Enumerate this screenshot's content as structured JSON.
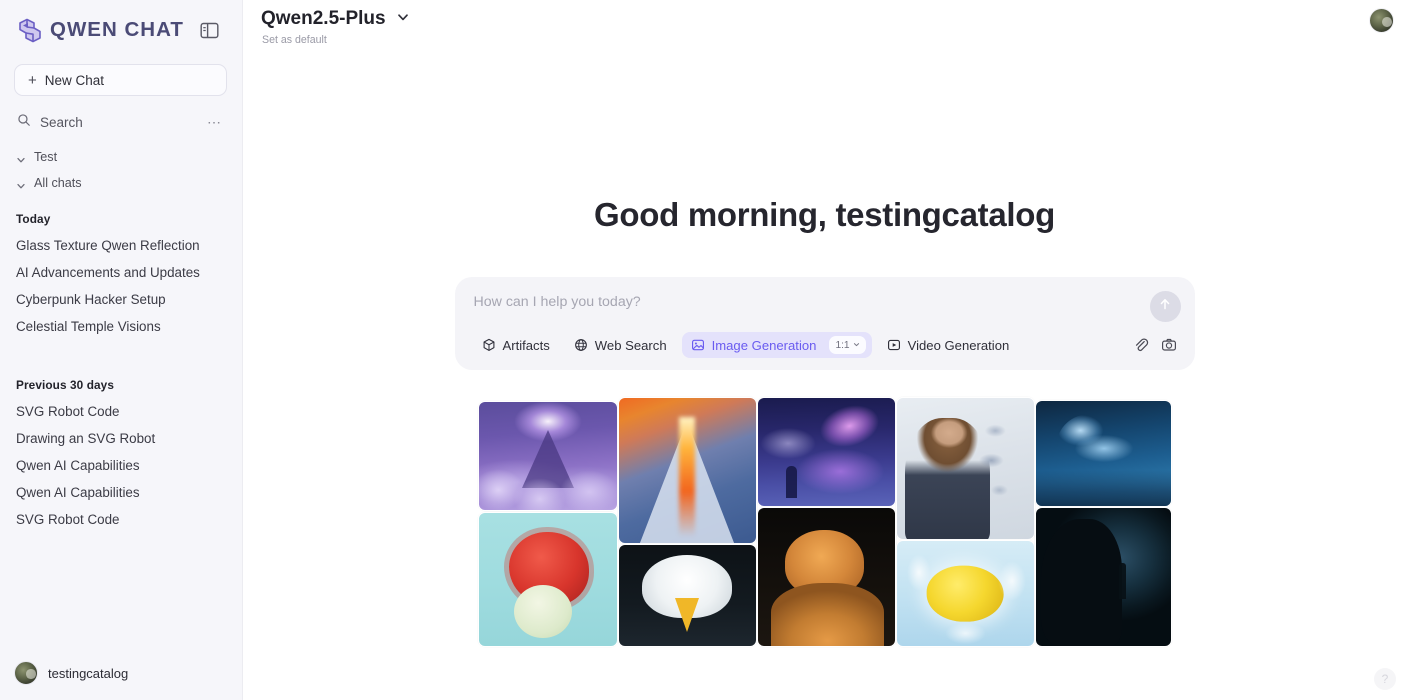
{
  "brand": {
    "name": "QWEN CHAT",
    "logo_icon": "qwen-logo-icon",
    "panel_toggle_icon": "panel-toggle-icon",
    "accent": "#6a5cf0",
    "brand_color": "#4b4b76"
  },
  "sidebar": {
    "new_chat_label": "New Chat",
    "new_chat_icon": "plus-icon",
    "search_label": "Search",
    "search_icon": "search-icon",
    "more_icon": "ellipsis-icon",
    "groups": [
      {
        "label": "Test",
        "icon": "chevron-down-icon"
      },
      {
        "label": "All chats",
        "icon": "chevron-down-icon"
      }
    ],
    "sections": [
      {
        "label": "Today",
        "items": [
          "Glass Texture Qwen Reflection",
          "AI Advancements and Updates",
          "Cyberpunk Hacker Setup",
          "Celestial Temple Visions"
        ]
      },
      {
        "label": "Previous 30 days",
        "items": [
          "SVG Robot Code",
          "Drawing an SVG Robot",
          "Qwen AI Capabilities",
          "Qwen AI Capabilities",
          "SVG Robot Code"
        ]
      }
    ],
    "footer": {
      "username": "testingcatalog",
      "avatar_icon": "user-avatar"
    }
  },
  "topbar": {
    "model_name": "Qwen2.5-Plus",
    "model_chevron_icon": "chevron-down-icon",
    "set_default_label": "Set as default",
    "avatar_icon": "user-avatar"
  },
  "main": {
    "greeting": "Good morning, testingcatalog",
    "composer": {
      "placeholder": "How can I help you today?",
      "send_icon": "arrow-up-icon",
      "tools": [
        {
          "label": "Artifacts",
          "icon": "cube-icon",
          "active": false
        },
        {
          "label": "Web Search",
          "icon": "globe-icon",
          "active": false
        },
        {
          "label": "Image Generation",
          "icon": "image-icon",
          "active": true,
          "ratio": "1:1",
          "ratio_icon": "chevron-down-icon"
        },
        {
          "label": "Video Generation",
          "icon": "video-icon",
          "active": false
        }
      ],
      "attachments": [
        {
          "icon": "paperclip-icon"
        },
        {
          "icon": "camera-icon"
        }
      ]
    },
    "gallery": {
      "tiles": [
        {
          "name": "celestial-temple-in-clouds"
        },
        {
          "name": "erupting-volcano-mountain"
        },
        {
          "name": "aurora-whale-over-sea"
        },
        {
          "name": "smiling-woman-presenting"
        },
        {
          "name": "ice-wolf-in-forest"
        },
        {
          "name": "red-spiky-bird-with-egg"
        },
        {
          "name": "bald-eagle-portrait"
        },
        {
          "name": "orange-tabby-cat"
        },
        {
          "name": "lemon-in-water-splash"
        },
        {
          "name": "woman-profile-silhouette"
        }
      ]
    },
    "help_label": "?"
  }
}
